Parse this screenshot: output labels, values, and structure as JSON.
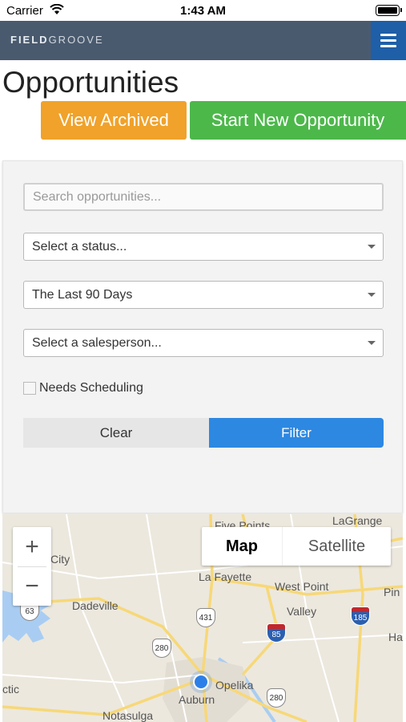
{
  "status_bar": {
    "carrier": "Carrier",
    "time": "1:43 AM"
  },
  "navbar": {
    "brand_part1": "FIELD",
    "brand_part2": "GROOVE"
  },
  "page": {
    "title": "Opportunities",
    "view_archived_label": "View Archived",
    "start_new_label": "Start New Opportunity"
  },
  "filters": {
    "search_placeholder": "Search opportunities...",
    "status_select": "Select a status...",
    "date_range_select": "The Last 90 Days",
    "salesperson_select": "Select a salesperson...",
    "needs_scheduling_label": "Needs Scheduling",
    "needs_scheduling_checked": false,
    "clear_label": "Clear",
    "filter_label": "Filter"
  },
  "map": {
    "map_type_options": [
      "Map",
      "Satellite"
    ],
    "selected_map_type": "Map",
    "zoom_in": "+",
    "zoom_out": "−",
    "labels": {
      "five_points": "Five Points",
      "lagrange": "LaGrange",
      "city": "City",
      "la_fayette": "La Fayette",
      "west_point": "West Point",
      "pin": "Pin",
      "dadeville": "Dadeville",
      "valley": "Valley",
      "ha": "Ha",
      "ctic": "ctic",
      "opelika": "Opelika",
      "auburn": "Auburn",
      "notasulga": "Notasulga"
    },
    "shields": {
      "r63": "63",
      "r431": "431",
      "r85": "85",
      "r185": "185",
      "r280a": "280",
      "r280b": "280"
    },
    "colors": {
      "water": "#a9cdf2",
      "road": "#f7d878",
      "minor_road": "#ffffff"
    }
  },
  "colors": {
    "navbar": "#4a5a6e",
    "menu_button": "#1e5fa8",
    "archived_button": "#f0a22a",
    "new_button": "#4cb84a",
    "filter_button": "#2d88e2"
  }
}
